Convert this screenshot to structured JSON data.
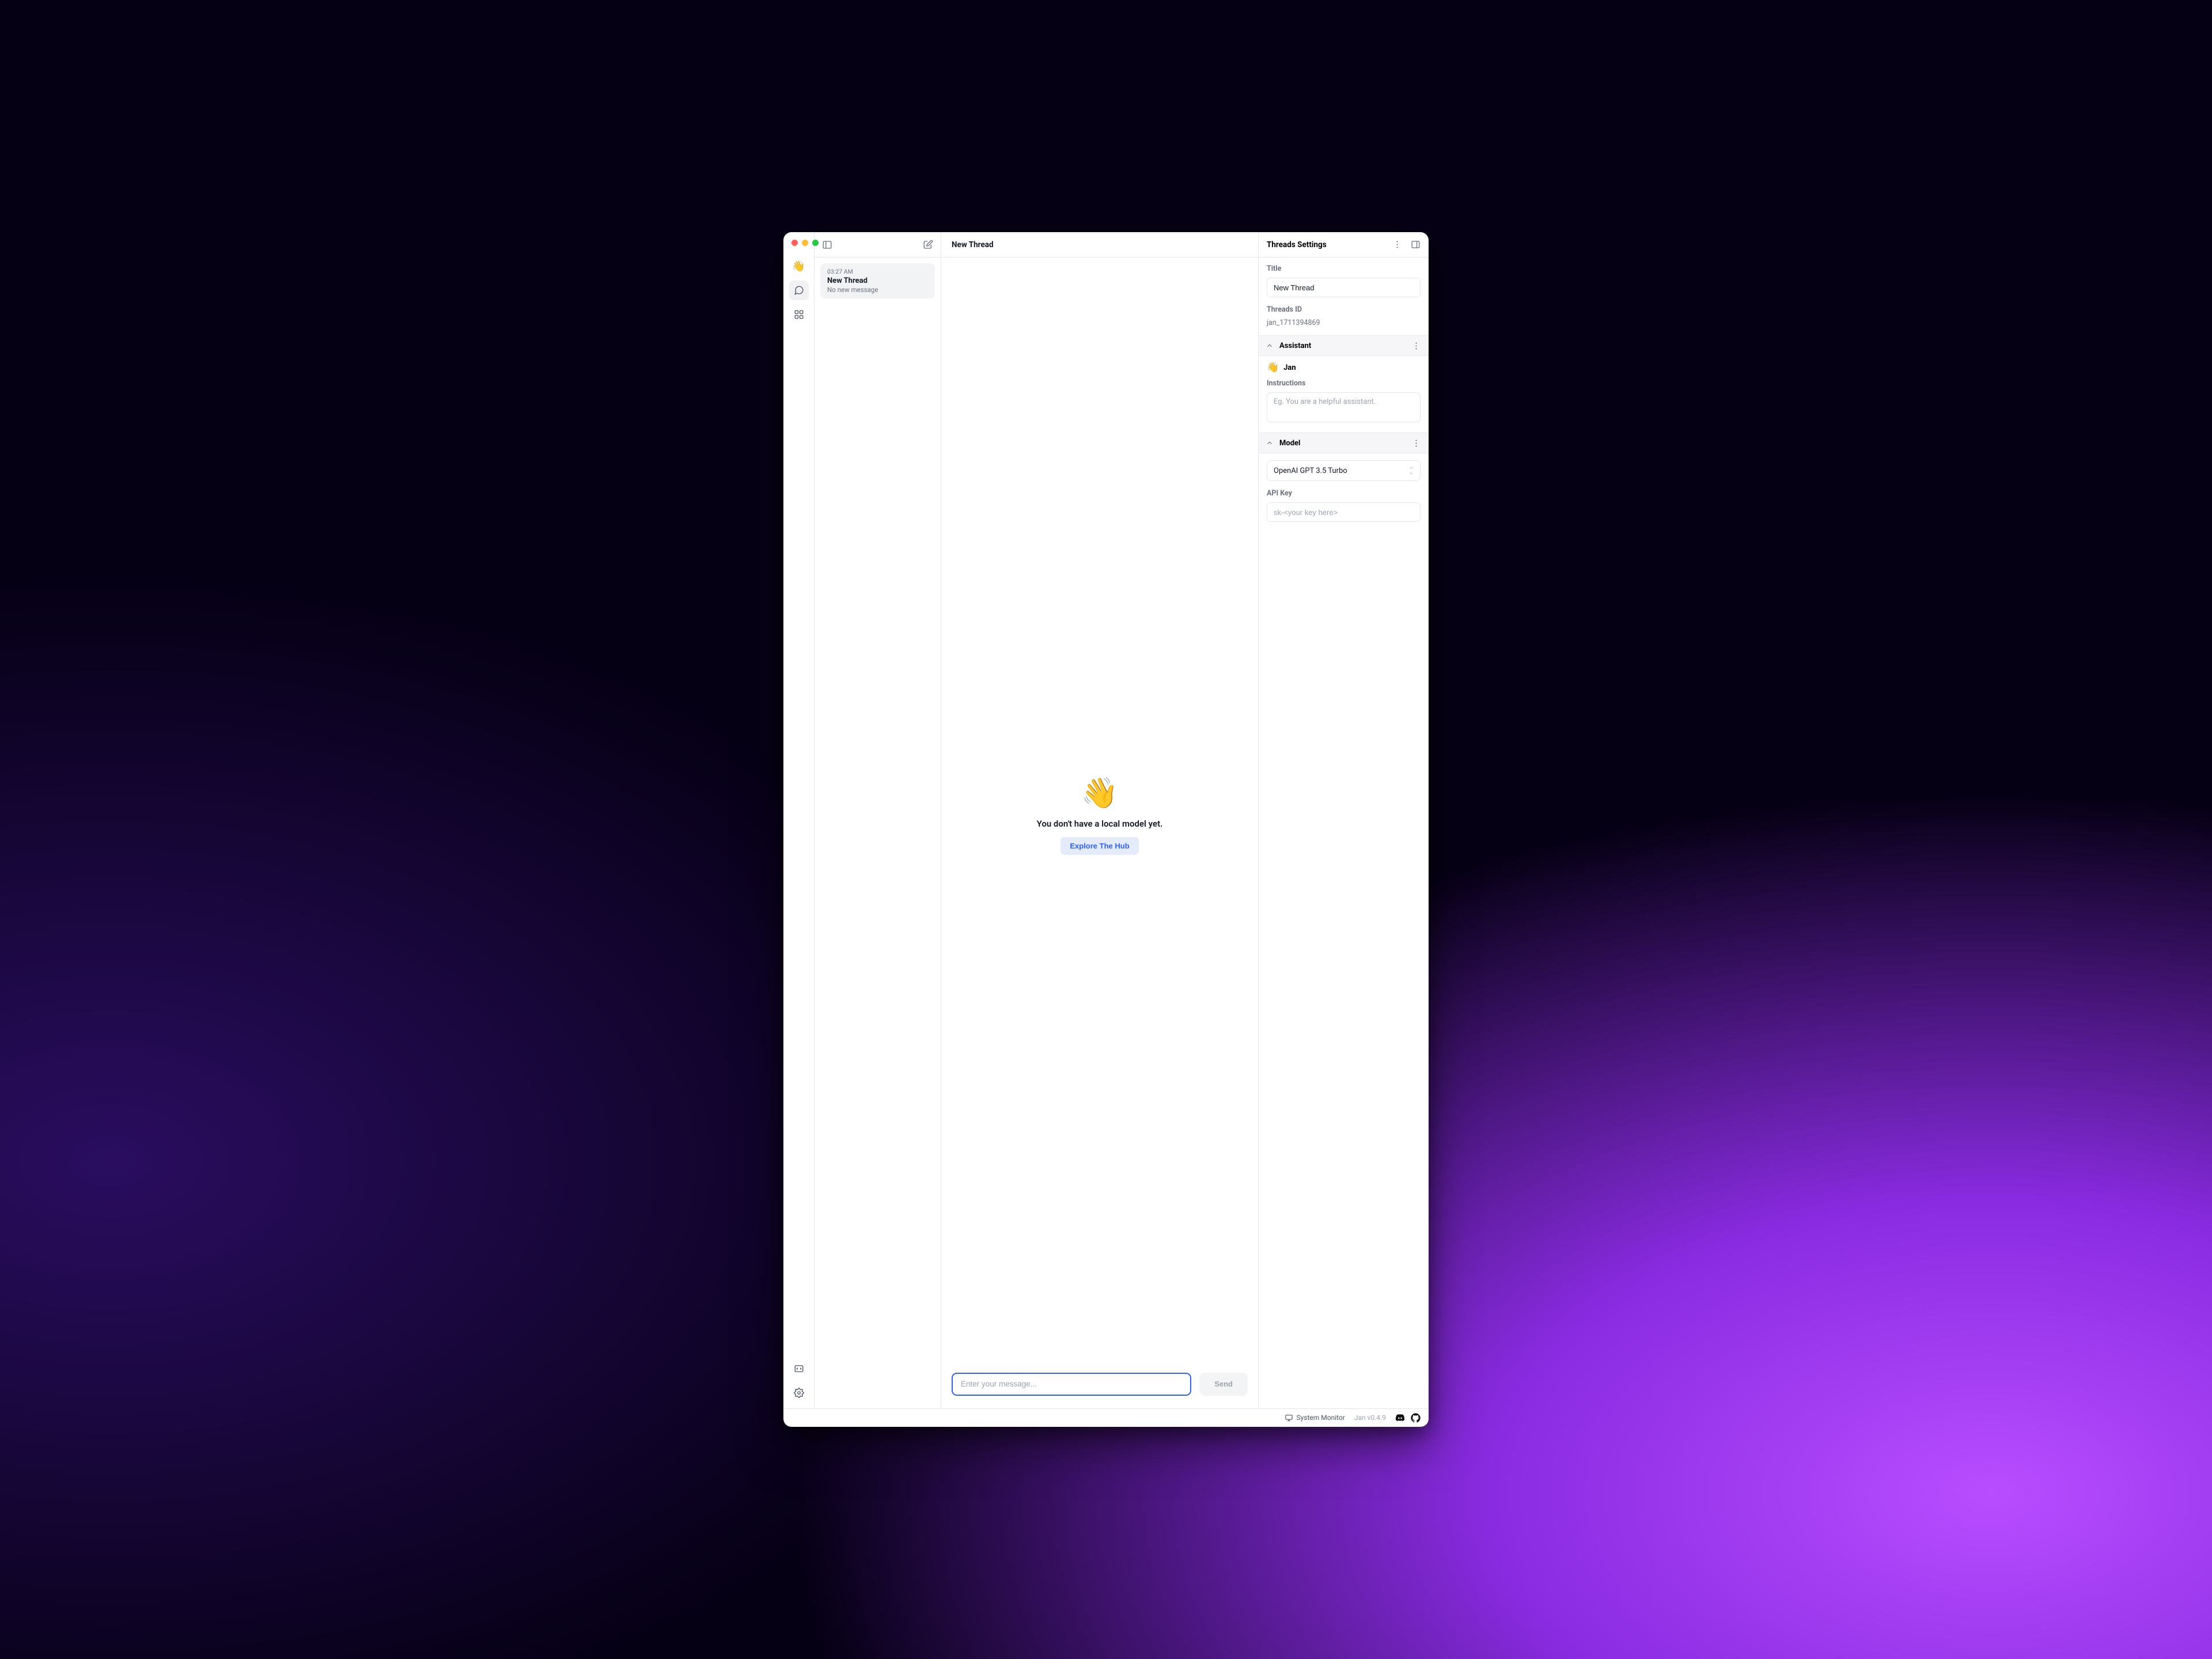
{
  "sidebar": {
    "icons": {
      "wave": "👋",
      "chat": "chat-icon",
      "grid": "grid-icon",
      "code": "code-icon",
      "settings": "gear-icon"
    }
  },
  "threadsHeader": {
    "collapseLeft": "panel-left-icon",
    "newThread": "compose-icon"
  },
  "threads": [
    {
      "time": "03:27 AM",
      "title": "New Thread",
      "subtitle": "No new message"
    }
  ],
  "main": {
    "header": "New Thread",
    "waveEmoji": "👋",
    "emptyText": "You don't have a local model yet.",
    "exploreButton": "Explore The Hub",
    "inputPlaceholder": "Enter your message...",
    "sendButton": "Send"
  },
  "settings": {
    "header": "Threads Settings",
    "title": {
      "label": "Title",
      "value": "New Thread"
    },
    "threadsId": {
      "label": "Threads ID",
      "value": "jan_1711394869"
    },
    "assistantSection": {
      "heading": "Assistant",
      "wave": "👋",
      "name": "Jan",
      "instructionsLabel": "Instructions",
      "instructionsPlaceholder": "Eg. You are a helpful assistant."
    },
    "modelSection": {
      "heading": "Model",
      "selected": "OpenAI GPT 3.5 Turbo",
      "apiKeyLabel": "API Key",
      "apiKeyPlaceholder": "sk-<your key here>"
    }
  },
  "statusbar": {
    "systemMonitor": "System Monitor",
    "version": "Jan v0.4.9"
  }
}
